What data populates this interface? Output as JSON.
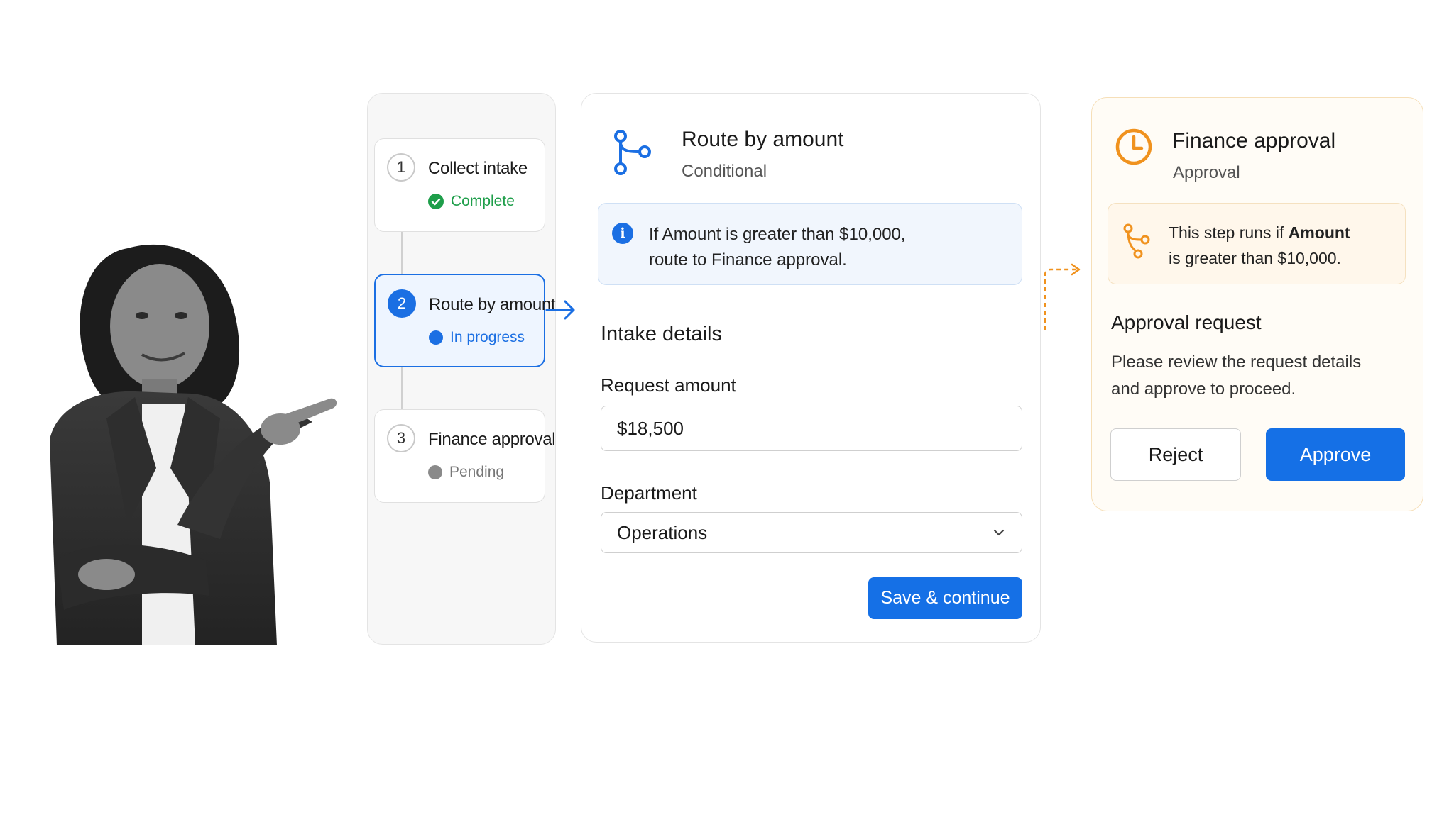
{
  "steps": [
    {
      "number": "1",
      "title": "Collect intake",
      "status": "Complete",
      "status_color": "#1e9e4a"
    },
    {
      "number": "2",
      "title": "Route by amount",
      "status": "In progress",
      "status_color": "#1b6fe3"
    },
    {
      "number": "3",
      "title": "Finance approval",
      "status": "Pending",
      "status_color": "#8a8a8a"
    }
  ],
  "route": {
    "title": "Route by amount",
    "subtitle": "Conditional",
    "info_line1": "If Amount is greater than $10,000,",
    "info_line2": "route to Finance approval.",
    "section_title": "Intake details",
    "amount_label": "Request amount",
    "amount_value": "$18,500",
    "department_label": "Department",
    "department_value": "Operations",
    "save_label": "Save & continue"
  },
  "finance": {
    "title": "Finance approval",
    "subtitle": "Approval",
    "condition_prefix": "This step runs if ",
    "condition_bold": "Amount",
    "condition_suffix": "is greater than $10,000.",
    "request_title": "Approval request",
    "request_desc": "Please review the request details and approve to proceed.",
    "reject_label": "Reject",
    "approve_label": "Approve"
  },
  "colors": {
    "accent_blue": "#1570e6",
    "accent_orange": "#f0921e",
    "complete_green": "#1e9e4a"
  },
  "icons": {
    "route": "branch-icon",
    "finance": "clock-icon",
    "info": "info-icon",
    "condition": "branch-icon"
  }
}
